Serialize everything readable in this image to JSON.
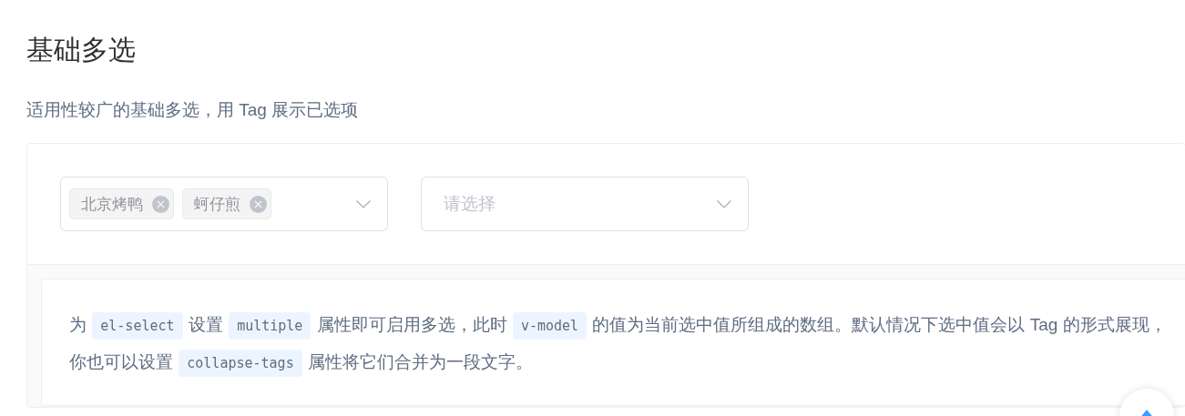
{
  "title": "基础多选",
  "subtitle": "适用性较广的基础多选，用 Tag 展示已选项",
  "selects": [
    {
      "tags": [
        {
          "label": "北京烤鸭"
        },
        {
          "label": "蚵仔煎"
        }
      ]
    },
    {
      "placeholder": "请选择"
    }
  ],
  "description": [
    {
      "kind": "text",
      "text": "为 "
    },
    {
      "kind": "code",
      "text": "el-select"
    },
    {
      "kind": "text",
      "text": " 设置 "
    },
    {
      "kind": "code",
      "text": "multiple"
    },
    {
      "kind": "text",
      "text": " 属性即可启用多选，此时 "
    },
    {
      "kind": "code",
      "text": "v-model"
    },
    {
      "kind": "text",
      "text": " 的值为当前选中值所组成的数组。默认情况下选中值会以 Tag 的形式展现，你也可以设置 "
    },
    {
      "kind": "code",
      "text": "collapse-tags"
    },
    {
      "kind": "text",
      "text": " 属性将它们合并为一段文字。"
    }
  ]
}
